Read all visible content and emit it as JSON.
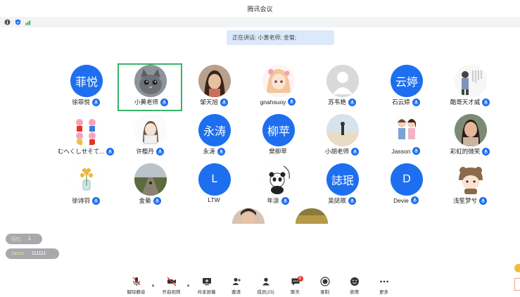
{
  "window": {
    "title": "腾讯会议"
  },
  "speaking": {
    "text": "正在讲话: 小黄老师; 金菊;"
  },
  "participants": [
    {
      "name": "徐菲悦",
      "avatar_text": "菲悦",
      "kind": "blue",
      "mic": true
    },
    {
      "name": "小黄老师",
      "avatar_text": "",
      "kind": "photo-cat",
      "mic": true,
      "active": true
    },
    {
      "name": "邹天旭",
      "avatar_text": "",
      "kind": "photo-girl",
      "mic": true
    },
    {
      "name": "gnahsuoy",
      "avatar_text": "",
      "kind": "photo-anime",
      "mic": true
    },
    {
      "name": "苏韦艳",
      "avatar_text": "",
      "kind": "default",
      "mic": true
    },
    {
      "name": "石云婷",
      "avatar_text": "云婷",
      "kind": "blue",
      "mic": true
    },
    {
      "name": "酷哥天才威",
      "avatar_text": "",
      "kind": "photo-sketch",
      "mic": true
    },
    {
      "name": "むへくしせそて...",
      "avatar_text": "",
      "kind": "photo-peppa",
      "mic": true
    },
    {
      "name": "许樱丹",
      "avatar_text": "",
      "kind": "photo-draw",
      "mic": true
    },
    {
      "name": "永涛",
      "avatar_text": "永涛",
      "kind": "blue",
      "mic": true
    },
    {
      "name": "樊柳苹",
      "avatar_text": "柳苹",
      "kind": "blue",
      "mic": false
    },
    {
      "name": "小胡老师",
      "avatar_text": "",
      "kind": "photo-beach",
      "mic": true
    },
    {
      "name": "Jasson",
      "avatar_text": "",
      "kind": "photo-couple",
      "mic": true
    },
    {
      "name": "彩虹的微笑",
      "avatar_text": "",
      "kind": "photo-woman",
      "mic": true
    },
    {
      "name": "徐诗羽",
      "avatar_text": "",
      "kind": "photo-flower",
      "mic": true
    },
    {
      "name": "金菊",
      "avatar_text": "",
      "kind": "photo-road",
      "mic": true
    },
    {
      "name": "LTW",
      "avatar_text": "L",
      "kind": "blue",
      "mic": false
    },
    {
      "name": "年涂",
      "avatar_text": "",
      "kind": "photo-panda",
      "mic": true
    },
    {
      "name": "吴誌珉",
      "avatar_text": "誌珉",
      "kind": "blue",
      "mic": true
    },
    {
      "name": "Devie",
      "avatar_text": "D",
      "kind": "blue",
      "mic": true
    },
    {
      "name": "浅笙梦兮",
      "avatar_text": "",
      "kind": "photo-bear",
      "mic": true
    }
  ],
  "chat": [
    {
      "who": "回忆",
      "text": "1"
    },
    {
      "who": "Jason",
      "text": "111111"
    }
  ],
  "toolbar": {
    "mute": "解除静音",
    "video": "开启视频",
    "share": "共享屏幕",
    "invite": "邀请",
    "members": "成员(23)",
    "chat": "聊天",
    "chat_badge": "8",
    "record": "录制",
    "reactions": "表情",
    "more": "更多"
  },
  "colors": {
    "accent": "#1e6ff0",
    "active_border": "#38b36b",
    "speaking_bg": "#dce9fb"
  }
}
